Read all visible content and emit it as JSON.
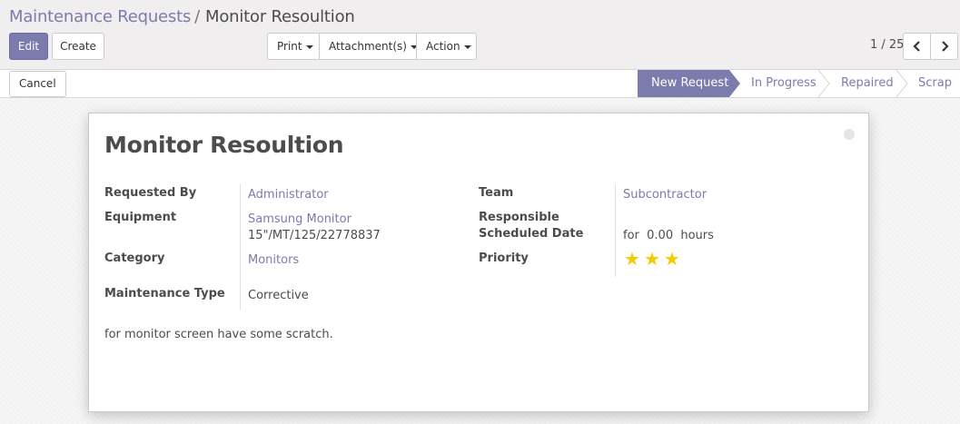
{
  "breadcrumb": {
    "parent": "Maintenance Requests",
    "separator": "/",
    "current": "Monitor Resoultion"
  },
  "toolbar": {
    "edit_label": "Edit",
    "create_label": "Create",
    "print_label": "Print",
    "attachments_label": "Attachment(s)",
    "action_label": "Action"
  },
  "pager": {
    "value": "1 / 25",
    "prev_icon": "chevron-left-icon",
    "next_icon": "chevron-right-icon"
  },
  "statusbar": {
    "cancel_label": "Cancel",
    "stages": [
      {
        "label": "New Request",
        "active": true
      },
      {
        "label": "In Progress",
        "active": false
      },
      {
        "label": "Repaired",
        "active": false
      },
      {
        "label": "Scrap",
        "active": false
      }
    ]
  },
  "form": {
    "title": "Monitor Resoultion",
    "fields": {
      "requested_by_label": "Requested By",
      "requested_by_value": "Administrator",
      "equipment_label": "Equipment",
      "equipment_value": "Samsung Monitor",
      "equipment_serial": "15\"/MT/125/22778837",
      "category_label": "Category",
      "category_value": "Monitors",
      "maintenance_type_label": "Maintenance Type",
      "maintenance_type_value": "Corrective",
      "team_label": "Team",
      "team_value": "Subcontractor",
      "responsible_label": "Responsible",
      "scheduled_date_label": "Scheduled Date",
      "duration_prefix": "for",
      "duration_value": "0.00",
      "duration_unit": "hours",
      "priority_label": "Priority",
      "priority_stars": 3,
      "priority_max": 3
    },
    "description": "for monitor screen have some scratch."
  },
  "colors": {
    "accent": "#7c7bad",
    "star": "#f3cc00"
  }
}
